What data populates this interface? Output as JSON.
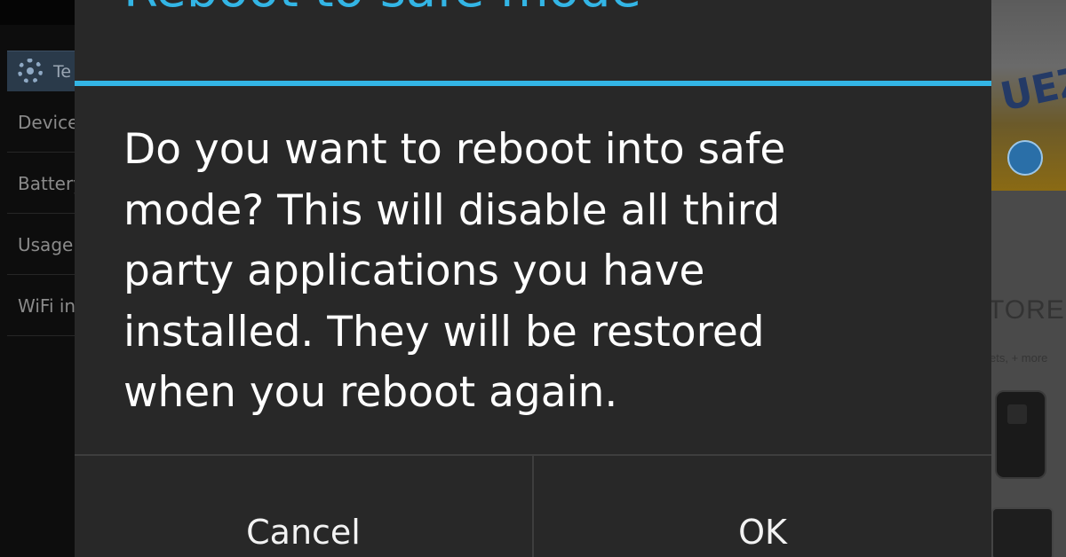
{
  "background_left": {
    "action_bar_title": "Te",
    "rows": [
      "Device",
      "Battery",
      "Usage",
      "WiFi info"
    ]
  },
  "background_right": {
    "brand_text": "UEZ",
    "store_text": "TORE",
    "more_text": "ets, + more"
  },
  "dialog": {
    "title": "Reboot to safe mode",
    "message": "Do you want to reboot into safe\nmode? This will disable all third\nparty applications you have\ninstalled. They will be restored\nwhen you reboot again.",
    "cancel_label": "Cancel",
    "ok_label": "OK"
  },
  "colors": {
    "accent": "#33b5e5",
    "dialog_background": "#282828",
    "button_divider": "#3e3e3e"
  }
}
